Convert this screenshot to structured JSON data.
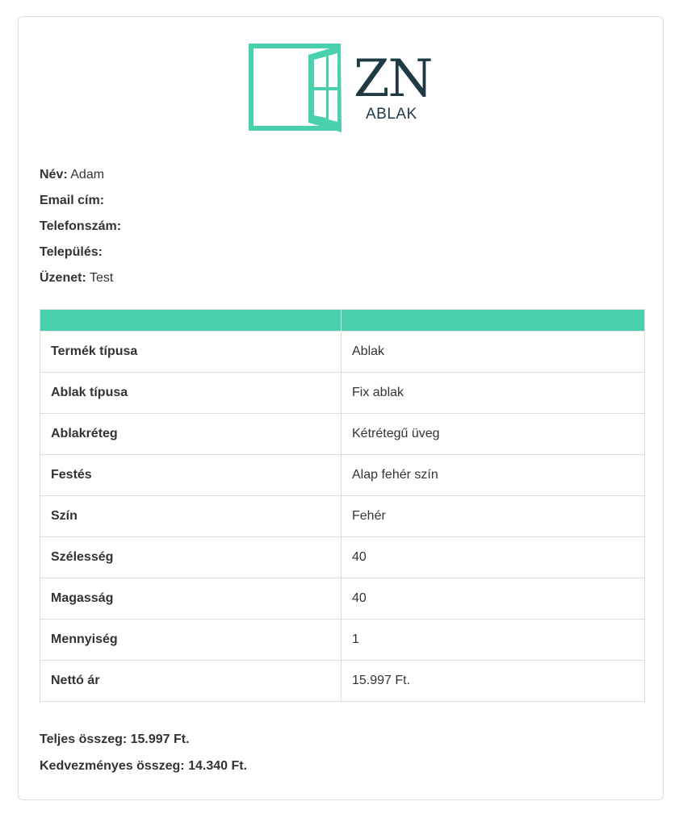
{
  "brand": {
    "logo_text": "ZN",
    "logo_subtext": "ABLAK",
    "accent_color": "#49d1ae",
    "dark_color": "#1f3a45"
  },
  "contact": [
    {
      "label": "Név:",
      "value": "Adam"
    },
    {
      "label": "Email cím:",
      "value": ""
    },
    {
      "label": "Telefonszám:",
      "value": ""
    },
    {
      "label": "Település:",
      "value": ""
    },
    {
      "label": "Üzenet:",
      "value": "Test"
    }
  ],
  "specs": {
    "header": [
      "",
      ""
    ],
    "rows": [
      {
        "key": "Termék típusa",
        "value": "Ablak"
      },
      {
        "key": "Ablak típusa",
        "value": "Fix ablak"
      },
      {
        "key": "Ablakréteg",
        "value": "Kétrétegű üveg"
      },
      {
        "key": "Festés",
        "value": "Alap fehér szín"
      },
      {
        "key": "Szín",
        "value": "Fehér"
      },
      {
        "key": "Szélesség",
        "value": "40"
      },
      {
        "key": "Magasság",
        "value": "40"
      },
      {
        "key": "Mennyiség",
        "value": "1"
      },
      {
        "key": "Nettó ár",
        "value": "15.997 Ft."
      }
    ]
  },
  "totals": {
    "total": "Teljes összeg: 15.997 Ft.",
    "discounted": "Kedvezményes összeg: 14.340 Ft."
  }
}
